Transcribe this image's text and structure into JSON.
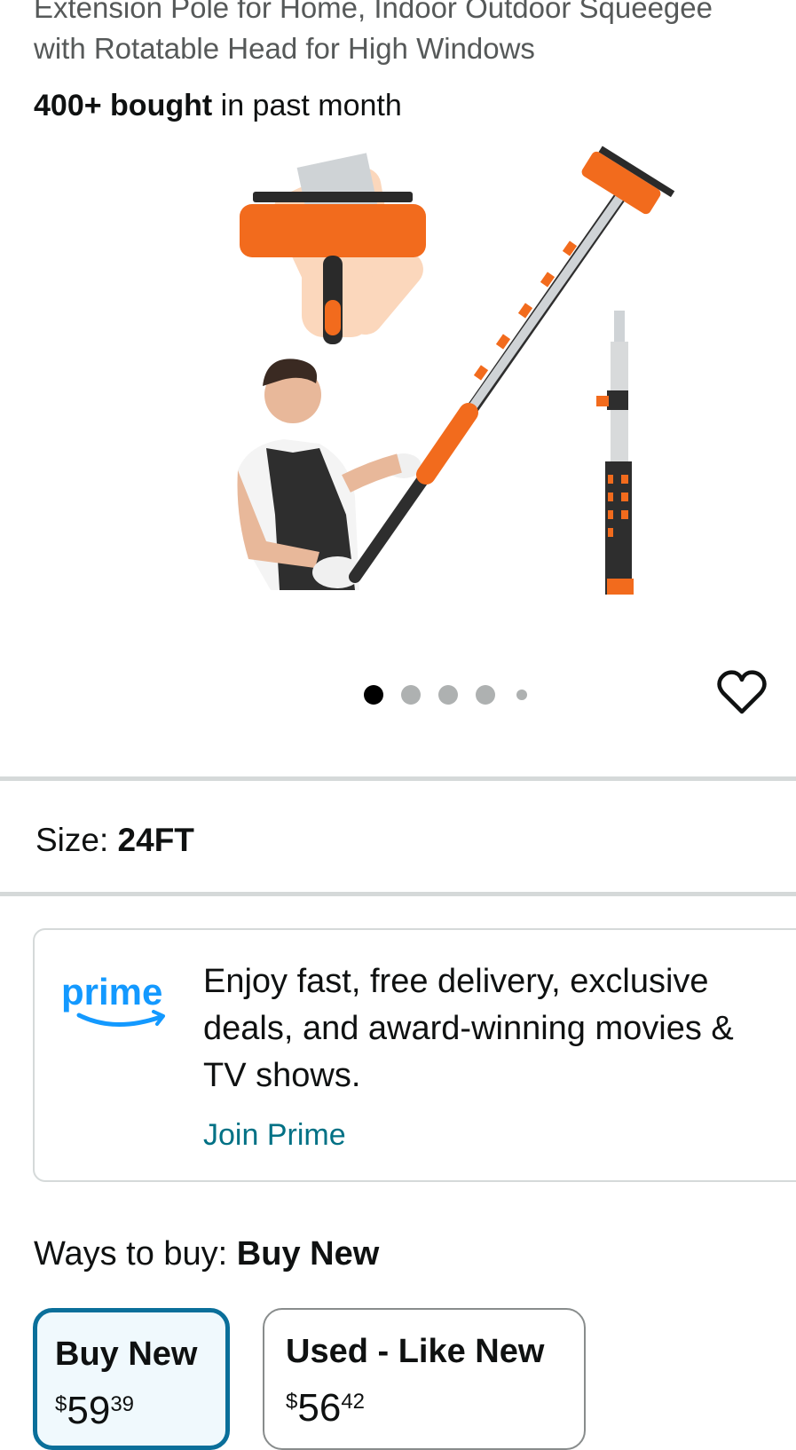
{
  "product": {
    "title_line1": "Extension Pole for Home, Indoor Outdoor Squeegee",
    "title_line2": "with Rotatable Head for High Windows",
    "bought_bold": "400+ bought",
    "bought_rest": " in past month"
  },
  "gallery": {
    "image_count": 5,
    "active_index": 0,
    "icons": [
      "window-squeegee-head",
      "person-with-pole",
      "extension-pole"
    ]
  },
  "size": {
    "label": "Size:",
    "value": "24FT"
  },
  "prime": {
    "logo_text": "prime",
    "line1": "Enjoy fast, free delivery, exclusive",
    "line2": "deals, and award-winning movies &",
    "line3": "TV shows.",
    "join_label": "Join Prime",
    "brand_color": "#1399ff"
  },
  "ways_to_buy": {
    "label": "Ways to buy:",
    "selected": "Buy New",
    "options": [
      {
        "label": "Buy New",
        "price_symbol": "$",
        "price_whole": "59",
        "price_fraction": "39",
        "selected": true
      },
      {
        "label": "Used - Like New",
        "price_symbol": "$",
        "price_whole": "56",
        "price_fraction": "42",
        "selected": false
      }
    ]
  },
  "colors": {
    "accent_orange": "#f26b1d",
    "link": "#007185",
    "selected_border": "#0a6f9a"
  }
}
